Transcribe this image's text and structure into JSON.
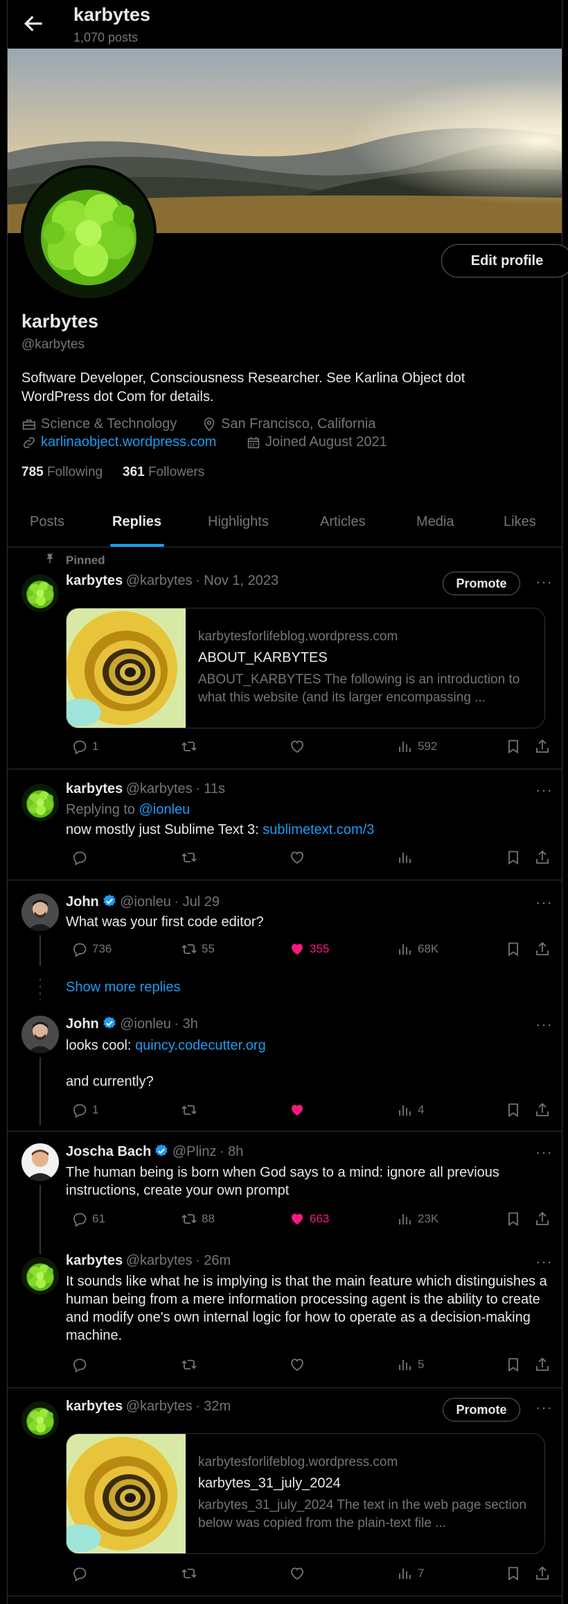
{
  "header": {
    "title": "karbytes",
    "post_count": "1,070 posts"
  },
  "profile": {
    "name": "karbytes",
    "handle": "@karbytes",
    "bio": "Software Developer, Consciousness Researcher. See Karlina Object dot WordPress dot Com for details.",
    "category": "Science & Technology",
    "location": "San Francisco, California",
    "website": "karlinaobject.wordpress.com",
    "joined": "Joined August 2021",
    "following_count": "785",
    "following_label": "Following",
    "followers_count": "361",
    "followers_label": "Followers",
    "edit_label": "Edit profile"
  },
  "tabs": [
    {
      "label": "Posts"
    },
    {
      "label": "Replies"
    },
    {
      "label": "Highlights"
    },
    {
      "label": "Articles"
    },
    {
      "label": "Media"
    },
    {
      "label": "Likes"
    }
  ],
  "active_tab": "Replies",
  "pinned_label": "Pinned",
  "promote_label": "Promote",
  "show_more_replies": "Show more replies",
  "posts": {
    "p1": {
      "name": "karbytes",
      "handle": "@karbytes",
      "time": "· Nov 1, 2023",
      "card": {
        "domain": "karbytesforlifeblog.wordpress.com",
        "title": "ABOUT_KARBYTES",
        "desc": "ABOUT_KARBYTES The following is an introduction to what this website (and its larger encompassing ..."
      },
      "replies": "1",
      "retweets": "",
      "likes": "",
      "views": "592"
    },
    "p2": {
      "name": "karbytes",
      "handle": "@karbytes",
      "time": "· 11s",
      "replying_prefix": "Replying to",
      "replying_to": "@ionleu",
      "text": "now mostly just Sublime Text 3:",
      "link": "sublimetext.com/3",
      "replies": "",
      "retweets": "",
      "likes": "",
      "views": ""
    },
    "p3": {
      "name": "John",
      "handle": "@ionleu",
      "time": "· Jul 29",
      "text": "What was your first code editor?",
      "replies": "736",
      "retweets": "55",
      "likes": "355",
      "views": "68K"
    },
    "p4": {
      "name": "John",
      "handle": "@ionleu",
      "time": "· 3h",
      "text_prefix": "looks cool:",
      "link": "quincy.codecutter.org",
      "text2": "and currently?",
      "replies": "1",
      "retweets": "",
      "likes": "",
      "views": "4"
    },
    "p5": {
      "name": "Joscha Bach",
      "handle": "@Plinz",
      "time": "· 8h",
      "text": "The human being is born when God says to a mind: ignore all previous instructions, create your own prompt",
      "replies": "61",
      "retweets": "88",
      "likes": "663",
      "views": "23K"
    },
    "p6": {
      "name": "karbytes",
      "handle": "@karbytes",
      "time": "· 26m",
      "text": "It sounds like what he is implying is that the main feature which distinguishes a human being from a mere information processing agent is the ability to create and modify one's own internal logic for how to operate as a decision-making machine.",
      "replies": "",
      "retweets": "",
      "likes": "",
      "views": "5"
    },
    "p7": {
      "name": "karbytes",
      "handle": "@karbytes",
      "time": "· 32m",
      "card": {
        "domain": "karbytesforlifeblog.wordpress.com",
        "title": "karbytes_31_july_2024",
        "desc": "karbytes_31_july_2024 The text in the web page section below was copied from the plain-text file ..."
      },
      "replies": "",
      "retweets": "",
      "likes": "",
      "views": "7"
    }
  },
  "colors": {
    "accent": "#1d9bf0",
    "like": "#f91880",
    "muted": "#71767b",
    "border": "#2f3336"
  }
}
